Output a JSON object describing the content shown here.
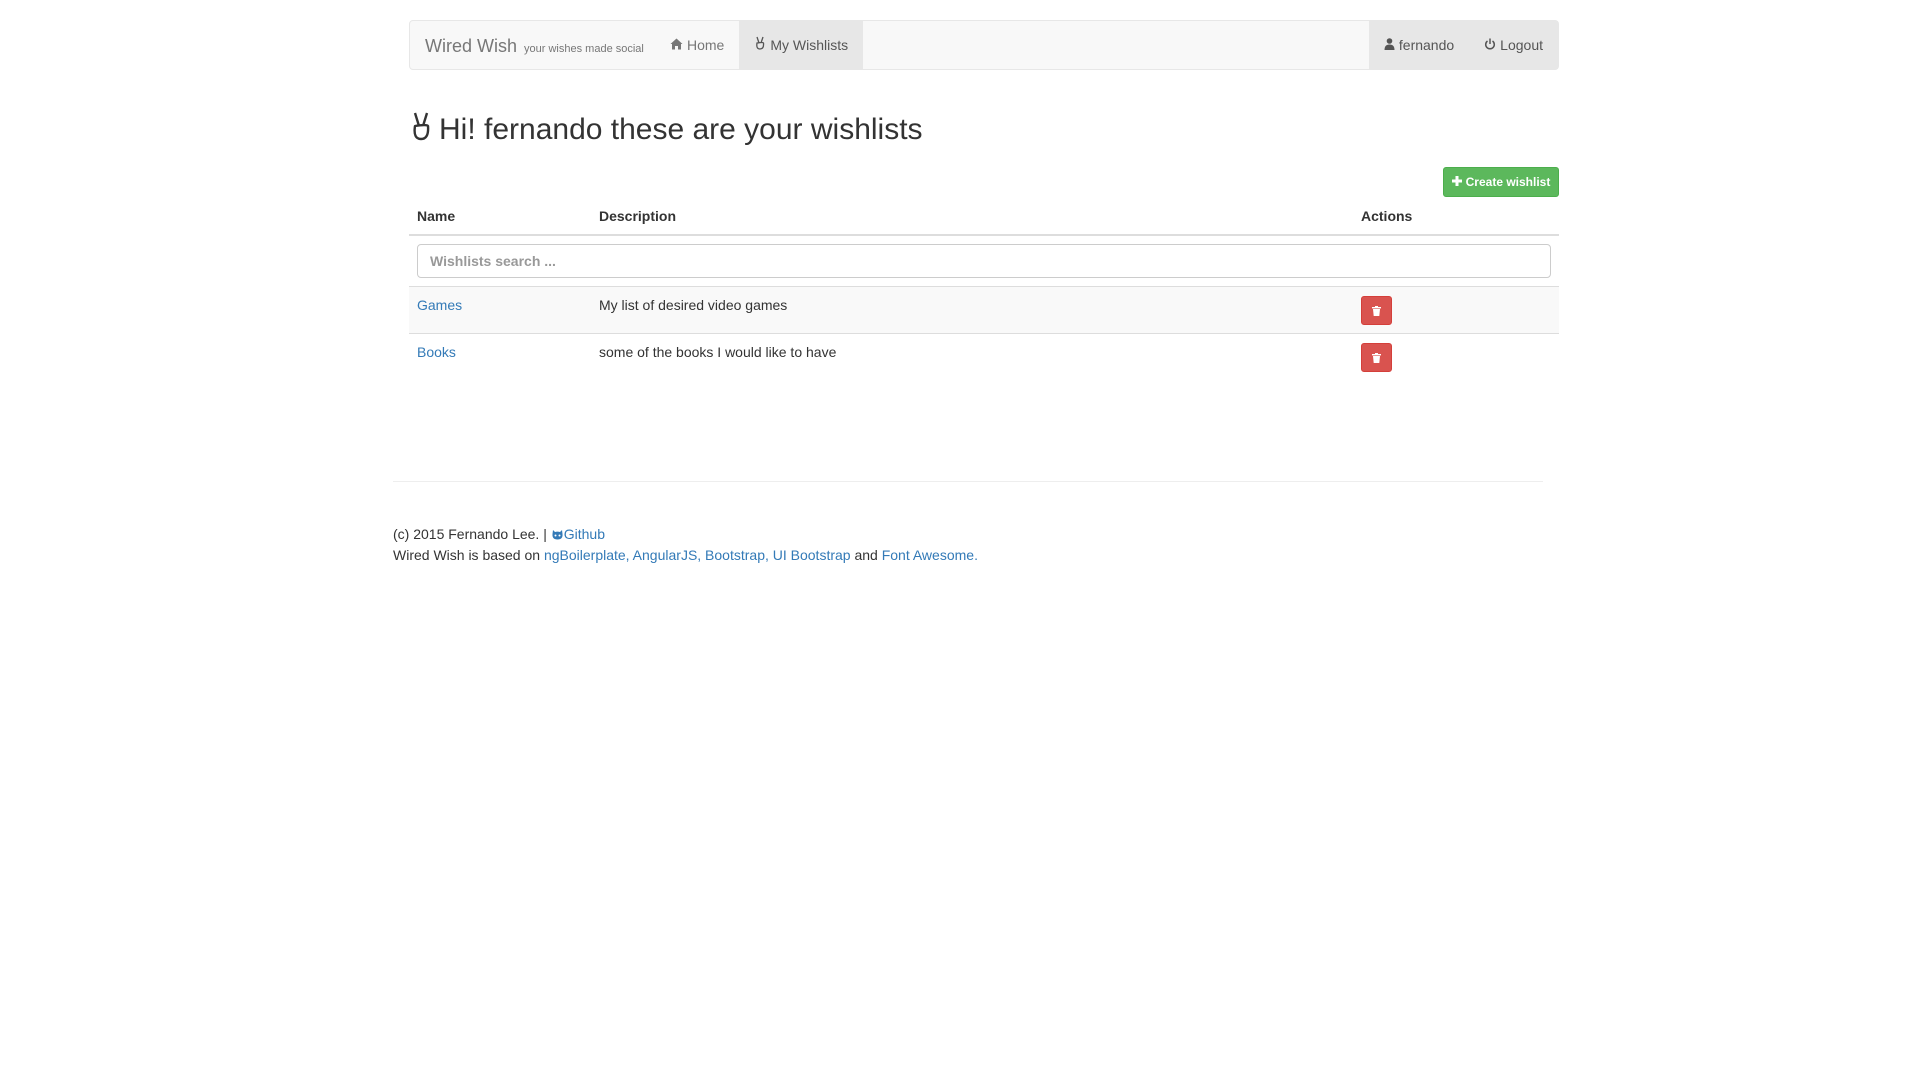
{
  "navbar": {
    "brand": "Wired Wish",
    "brand_tagline": "your wishes made social",
    "home_label": "Home",
    "wishlists_label": "My Wishlists",
    "user_label": "fernando",
    "logout_label": "Logout"
  },
  "page": {
    "heading": "Hi! fernando these are your wishlists",
    "create_label": "Create wishlist"
  },
  "table": {
    "headers": {
      "name": "Name",
      "description": "Description",
      "actions": "Actions"
    },
    "search_placeholder": "Wishlists search ...",
    "rows": [
      {
        "name": "Games",
        "description": "My list of desired video games"
      },
      {
        "name": "Books",
        "description": "some of the books I would like to have"
      }
    ]
  },
  "footer": {
    "copyright": "(c) 2015 Fernando Lee. |",
    "github_label": "Github",
    "based_on_text": "Wired Wish is based on",
    "links_label": "ngBoilerplate, AngularJS, Bootstrap, UI Bootstrap",
    "and_text": "and",
    "font_awesome_label": "Font Awesome."
  },
  "colors": {
    "success": "#5cb85c",
    "danger": "#d9534f",
    "link": "#337ab7"
  }
}
